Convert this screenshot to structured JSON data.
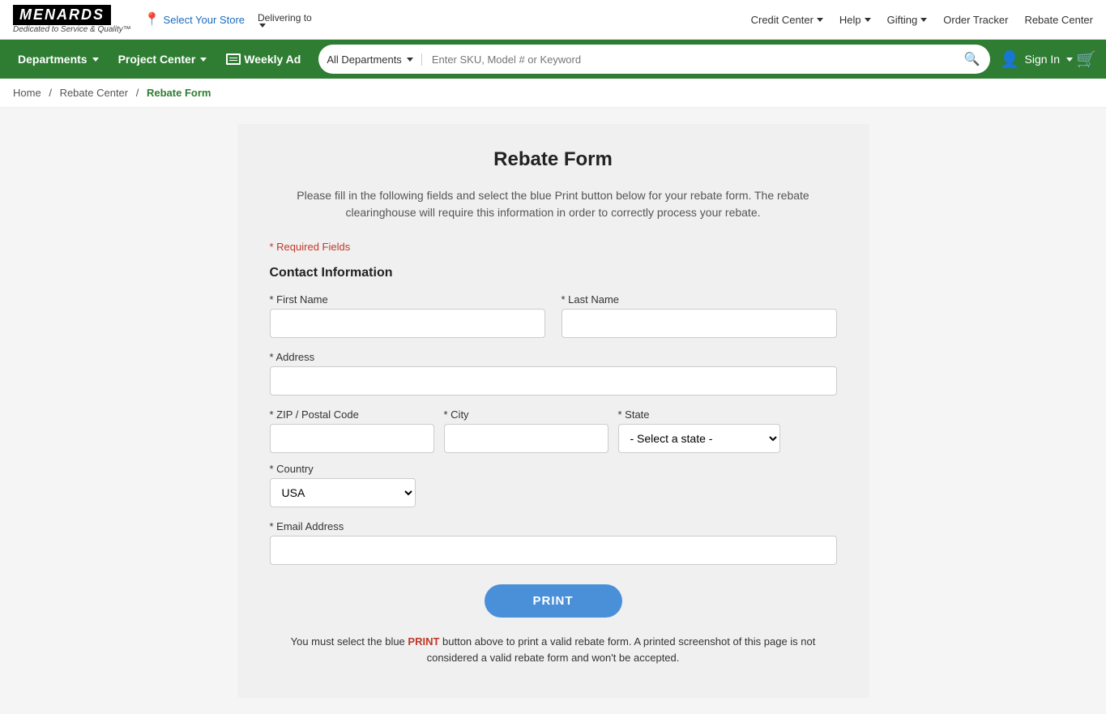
{
  "topbar": {
    "logo": "MENARDS",
    "logo_subtitle": "Dedicated to Service & Quality™",
    "store_selector": "Select Your Store",
    "delivering_to": "Delivering to",
    "credit_center": "Credit Center",
    "help": "Help",
    "gifting": "Gifting",
    "order_tracker": "Order Tracker",
    "rebate_center": "Rebate Center"
  },
  "navbar": {
    "departments": "Departments",
    "project_center": "Project Center",
    "weekly_ad": "Weekly Ad",
    "search_dept": "All Departments",
    "search_placeholder": "Enter SKU, Model # or Keyword",
    "sign_in": "Sign In"
  },
  "breadcrumb": {
    "home": "Home",
    "rebate_center": "Rebate Center",
    "current": "Rebate Form"
  },
  "form": {
    "title": "Rebate Form",
    "description": "Please fill in the following fields and select the blue Print button below for your rebate form. The rebate clearinghouse will require this information in order to correctly process your rebate.",
    "required_note": "* Required Fields",
    "section_contact": "Contact Information",
    "first_name_label": "* First Name",
    "last_name_label": "* Last Name",
    "address_label": "* Address",
    "zip_label": "* ZIP / Postal Code",
    "city_label": "* City",
    "state_label": "* State",
    "country_label": "* Country",
    "email_label": "* Email Address",
    "state_default": "- Select a state -",
    "country_default": "USA",
    "print_button": "PRINT",
    "print_notice": "You must select the blue PRINT button above to print a valid rebate form. A printed screenshot of this page is not considered a valid rebate form and won't be accepted.",
    "print_highlight": "PRINT"
  }
}
